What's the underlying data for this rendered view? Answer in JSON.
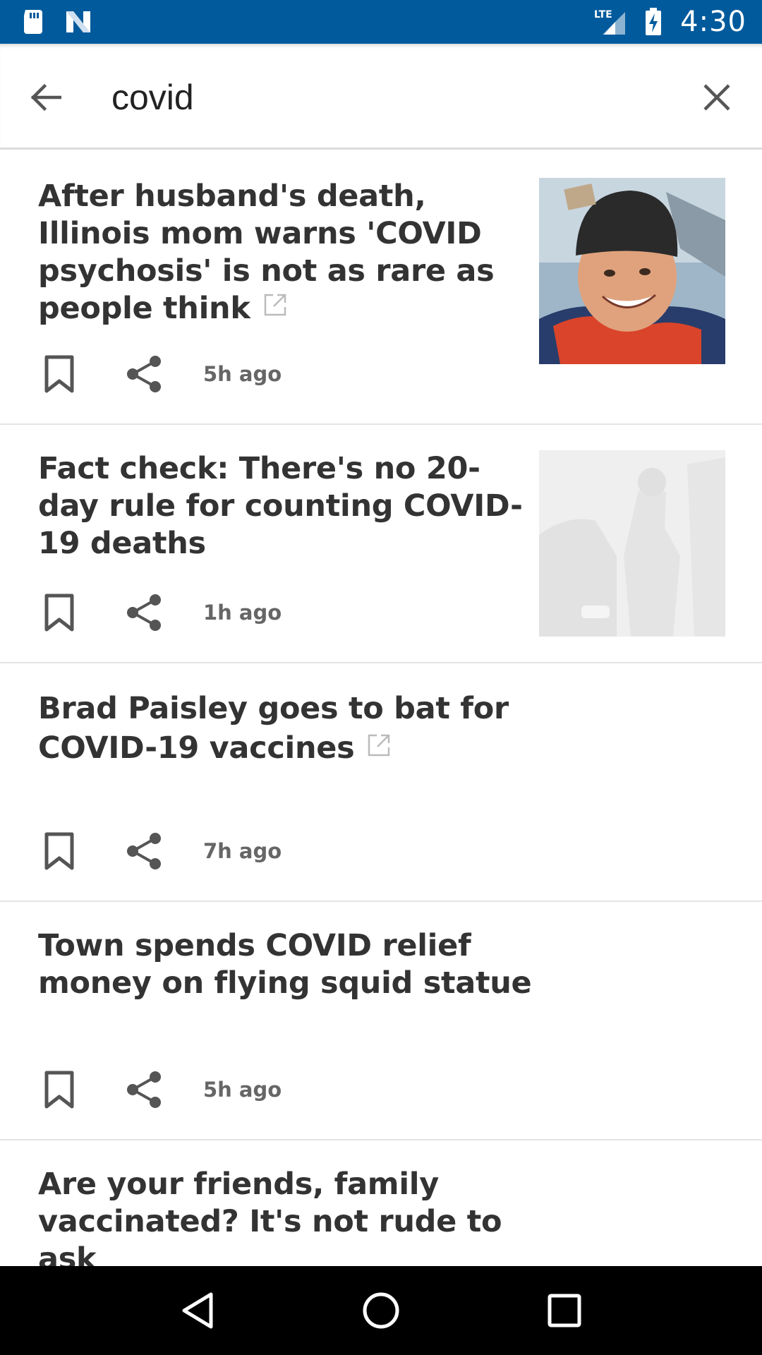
{
  "status_bar": {
    "time": "4:30",
    "network": "LTE",
    "icons": [
      "sd-card-icon",
      "n-logo-icon",
      "lte-signal-icon",
      "battery-charging-icon"
    ]
  },
  "search": {
    "query": "covid",
    "back_icon": "arrow-left-icon",
    "clear_icon": "close-icon"
  },
  "articles": [
    {
      "headline": "After husband's death, Illinois mom warns 'COVID psychosis' is not as rare as people think",
      "external_link": true,
      "time_ago": "5h ago",
      "has_thumbnail": true,
      "thumbnail": "man-in-beanie-photo"
    },
    {
      "headline": "Fact check: There's no 20-day rule for counting COVID-19 deaths",
      "external_link": false,
      "time_ago": "1h ago",
      "has_thumbnail": true,
      "thumbnail": "faded-car-photo"
    },
    {
      "headline": "Brad Paisley goes to bat for COVID-19 vaccines",
      "external_link": true,
      "time_ago": "7h ago",
      "has_thumbnail": false
    },
    {
      "headline": "Town spends COVID relief money on flying squid statue",
      "external_link": false,
      "time_ago": "5h ago",
      "has_thumbnail": false
    },
    {
      "headline": "Are your friends, family vaccinated? It's not rude to ask",
      "external_link": false,
      "time_ago": "",
      "has_thumbnail": false
    }
  ],
  "nav_bar": {
    "icons": [
      "back-triangle-icon",
      "home-circle-icon",
      "recents-square-icon"
    ]
  },
  "colors": {
    "status_bar": "#005a9c",
    "headline_text": "#333333",
    "meta_text": "#666666",
    "icon_gray": "#555555"
  }
}
